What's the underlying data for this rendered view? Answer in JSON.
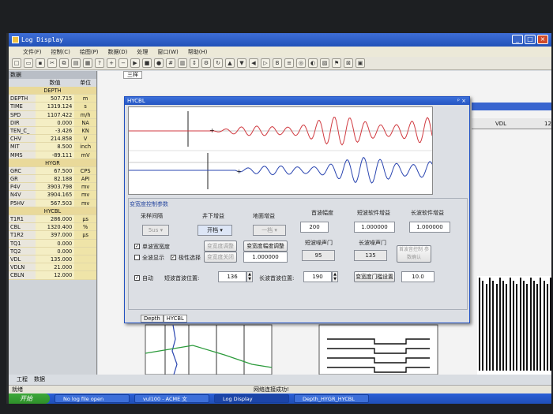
{
  "window": {
    "title": "Log Display"
  },
  "menu": [
    "文件(F)",
    "控制(C)",
    "绘图(P)",
    "数据(D)",
    "处理",
    "窗口(W)",
    "帮助(H)"
  ],
  "data_panel": {
    "title": "数据",
    "col_value": "数值",
    "col_unit": "单位",
    "groups": [
      {
        "name": "DEPTH",
        "rows": [
          {
            "name": "DEPTH",
            "value": "507.715",
            "unit": "m"
          },
          {
            "name": "TIME",
            "value": "1319.124",
            "unit": "s"
          },
          {
            "name": "SPD",
            "value": "1107.422",
            "unit": "m/h"
          },
          {
            "name": "DIR",
            "value": "0.000",
            "unit": "NA"
          },
          {
            "name": "TEN_C_",
            "value": "-3.426",
            "unit": "KN"
          },
          {
            "name": "CHV",
            "value": "214.858",
            "unit": "V"
          },
          {
            "name": "MIT",
            "value": "8.500",
            "unit": "inch"
          },
          {
            "name": "MMS",
            "value": "-89.111",
            "unit": "mV"
          }
        ]
      },
      {
        "name": "HYGR",
        "rows": [
          {
            "name": "GRC",
            "value": "67.500",
            "unit": "CPS"
          },
          {
            "name": "GR",
            "value": "82.188",
            "unit": "API"
          },
          {
            "name": "P4V",
            "value": "3903.798",
            "unit": "mv"
          },
          {
            "name": "N4V",
            "value": "3904.165",
            "unit": "mv"
          },
          {
            "name": "P5HV",
            "value": "567.503",
            "unit": "mv"
          }
        ]
      },
      {
        "name": "HYCBL",
        "rows": [
          {
            "name": "T1R1",
            "value": "286.000",
            "unit": "µs"
          },
          {
            "name": "CBL",
            "value": "1320.400",
            "unit": "%"
          },
          {
            "name": "T1R2",
            "value": "397.000",
            "unit": "µs"
          },
          {
            "name": "TQ1",
            "value": "0.000",
            "unit": ""
          },
          {
            "name": "TQ2",
            "value": "0.000",
            "unit": ""
          },
          {
            "name": "VDL",
            "value": "135.000",
            "unit": ""
          },
          {
            "name": "VDLN",
            "value": "21.000",
            "unit": ""
          },
          {
            "name": "CBLN",
            "value": "12.000",
            "unit": ""
          }
        ]
      }
    ]
  },
  "bottom_tabs": [
    "工程",
    "数据"
  ],
  "status": {
    "left": "就绪",
    "center": "网络连接成功!"
  },
  "track": {
    "tab": "三样",
    "vdl": "VDL",
    "num": "12"
  },
  "dialog": {
    "title": "HYCBL",
    "group_title": "变宽度控制参数",
    "labels": {
      "sample_interval": "采样间隔",
      "downhole_gain": "井下增益",
      "surface_gain": "地面增益",
      "first_wave_amp": "首波幅度",
      "short_sw_gain": "短波软件增益",
      "long_sw_gain": "长波软件增益",
      "short_gate": "短波噪声门",
      "long_gate": "长波噪声门",
      "short_first_pos": "短波首波位置:",
      "long_first_pos": "长波首波位置:"
    },
    "values": {
      "sample_interval": "5us",
      "downhole_gain": "开档",
      "surface_gain": "一档",
      "first_wave_amp": "200",
      "short_sw_gain": "1.000000",
      "long_sw_gain": "1.000000",
      "gain_value": "1.000000",
      "short_gate": "95",
      "long_gate": "135",
      "short_first_pos": "136",
      "long_first_pos": "190",
      "last_value": "10.0"
    },
    "checkboxes": {
      "single_width": "单波宽宽度",
      "full_wave": "全波显示",
      "polarity": "极性选择",
      "auto": "自动"
    },
    "buttons": {
      "width_adjust": "变宽度调整",
      "width_amp_adjust": "变宽度幅度调整",
      "width_close": "变宽度关闭",
      "first_wave_ctrl": "首波音控制 参数确认",
      "gate_set": "变宽度门槛设置"
    },
    "tabs": [
      "Depth",
      "HYCBL"
    ]
  },
  "taskbar": {
    "start": "开始",
    "items": [
      "No log file open",
      "vul100 - ACME 文",
      "Log Display",
      "Depth_HYGR_HYCBL"
    ]
  },
  "colors": {
    "short_wave": "#d03a40",
    "long_wave": "#2a45b0",
    "title_blue": "#2455c2"
  }
}
